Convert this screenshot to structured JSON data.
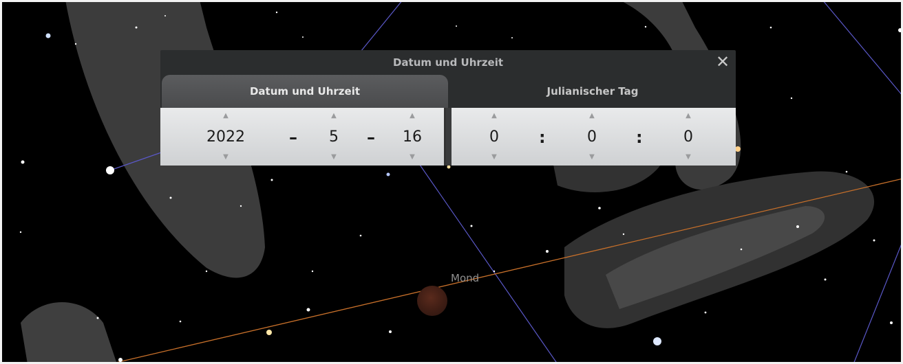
{
  "sky": {
    "object_label": "Mond"
  },
  "dialog": {
    "title": "Datum und Uhrzeit",
    "close_symbol": "✕",
    "tabs": [
      {
        "label": "Datum und Uhrzeit",
        "active": true
      },
      {
        "label": "Julianischer Tag",
        "active": false
      }
    ],
    "date": {
      "year": "2022",
      "month": "5",
      "day": "16",
      "separator": "–"
    },
    "time": {
      "hour": "0",
      "minute": "0",
      "second": "0",
      "separator": ":"
    },
    "spinner_up": "▲",
    "spinner_down": "▼"
  },
  "colors": {
    "dialog_bg": "#2b2d2e",
    "active_tab": "#54565a",
    "panel": "#dcdee0",
    "ecliptic": "#c8702a",
    "constellation_lines": "#5a58c8"
  },
  "icons": [
    "close-icon",
    "arrow-up-icon",
    "arrow-down-icon"
  ]
}
